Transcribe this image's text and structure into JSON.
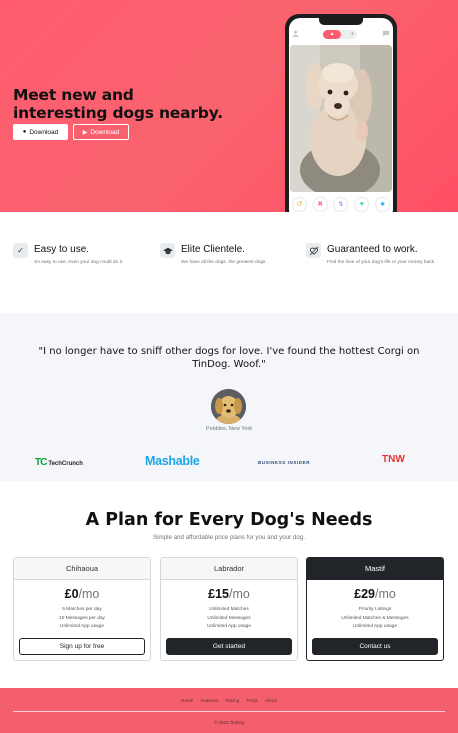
{
  "hero": {
    "title": "Meet new and interesting dogs nearby.",
    "btn_apple": "Download",
    "btn_play": "Download",
    "accent": "#ff5c70"
  },
  "phone": {
    "icons": [
      "profile-icon",
      "flame-icon",
      "chat-icon"
    ],
    "actions": [
      "undo-icon",
      "close-icon",
      "bolt-icon",
      "heart-icon",
      "star-icon"
    ]
  },
  "features": [
    {
      "icon": "check-circle-icon",
      "title": "Easy to use.",
      "desc": "So easy to use, even your dog could do it."
    },
    {
      "icon": "graduation-cap-icon",
      "title": "Elite Clientele.",
      "desc": "We have all the dogs, the greatest dogs."
    },
    {
      "icon": "heart-arrow-icon",
      "title": "Guaranteed to work.",
      "desc": "Find the love of your dog's life or your money back."
    }
  ],
  "testimonial": {
    "quote": "\"I no longer have to sniff other dogs for love. I've found the hottest Corgi on TinDog. Woof.\"",
    "name": "Pebbles, New York"
  },
  "press": {
    "techcrunch_mark": "TC",
    "techcrunch": "TechCrunch",
    "mashable": "Mashable",
    "business_insider": "BUSINESS INSIDER",
    "tnw": "TNW"
  },
  "pricing": {
    "title": "A Plan for Every Dog's Needs",
    "subtitle": "Simple and affordable price plans for you and your dog.",
    "plans": [
      {
        "name": "Chihaoua",
        "price": "£0",
        "per": "/mo",
        "features": [
          "5 Matches per day",
          "10 Messages per day",
          "Unlimited App usage"
        ],
        "cta": "Sign up for free"
      },
      {
        "name": "Labrador",
        "price": "£15",
        "per": "/mo",
        "features": [
          "Unlimited Matches",
          "Unlimited Messages",
          "Unlimited App usage"
        ],
        "cta": "Get started"
      },
      {
        "name": "Mastif",
        "price": "£29",
        "per": "/mo",
        "features": [
          "Priority Listings",
          "Unlimited Matches & Messages",
          "Unlimited App usage"
        ],
        "cta": "Contact us"
      }
    ]
  },
  "footer": {
    "nav": [
      "Home",
      "Features",
      "Pricing",
      "FAQs",
      "About"
    ],
    "copyright": "© 2023 TinDog"
  }
}
